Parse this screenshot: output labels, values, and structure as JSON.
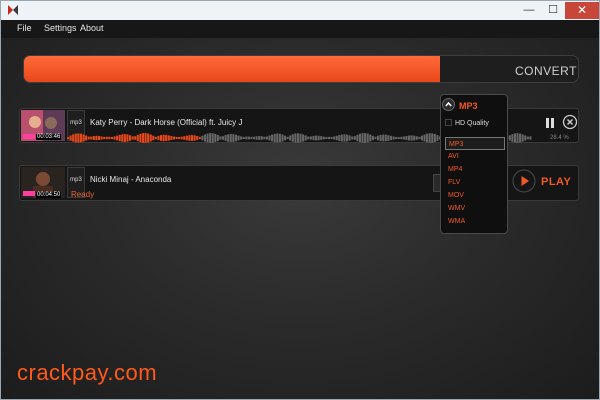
{
  "menu": {
    "items": [
      "File",
      "Settings",
      "About"
    ]
  },
  "window": {
    "minimize_glyph": "—",
    "maximize_glyph": "☐",
    "close_glyph": "✕"
  },
  "convert": {
    "progress": 0.75,
    "label": "CONVERT"
  },
  "format_menu": {
    "selected": "MP3",
    "hd_label": "HD Quality",
    "options": [
      "MP3",
      "AVI",
      "MP4",
      "FLV",
      "MOV",
      "WMV",
      "WMA"
    ],
    "active_index": 0
  },
  "items": [
    {
      "format": "mp3",
      "title": "Katy Perry - Dark Horse (Official) ft. Juicy J",
      "duration": "00:03:46",
      "progress": 0.284,
      "percent": "28.4 %",
      "status": ""
    },
    {
      "format": "mp3",
      "title": "Nicki Minaj - Anaconda",
      "duration": "00:04:50",
      "status": "Ready"
    }
  ],
  "play": {
    "label": "PLAY"
  },
  "watermark": "crackpay.com",
  "colors": {
    "accent": "#f05a22",
    "progress": "#ff5a1a",
    "window_close": "#c8453a"
  },
  "icons": [
    "app-logo-icon",
    "chevron-up-icon",
    "pause-icon",
    "close-circle-icon",
    "play-icon"
  ]
}
